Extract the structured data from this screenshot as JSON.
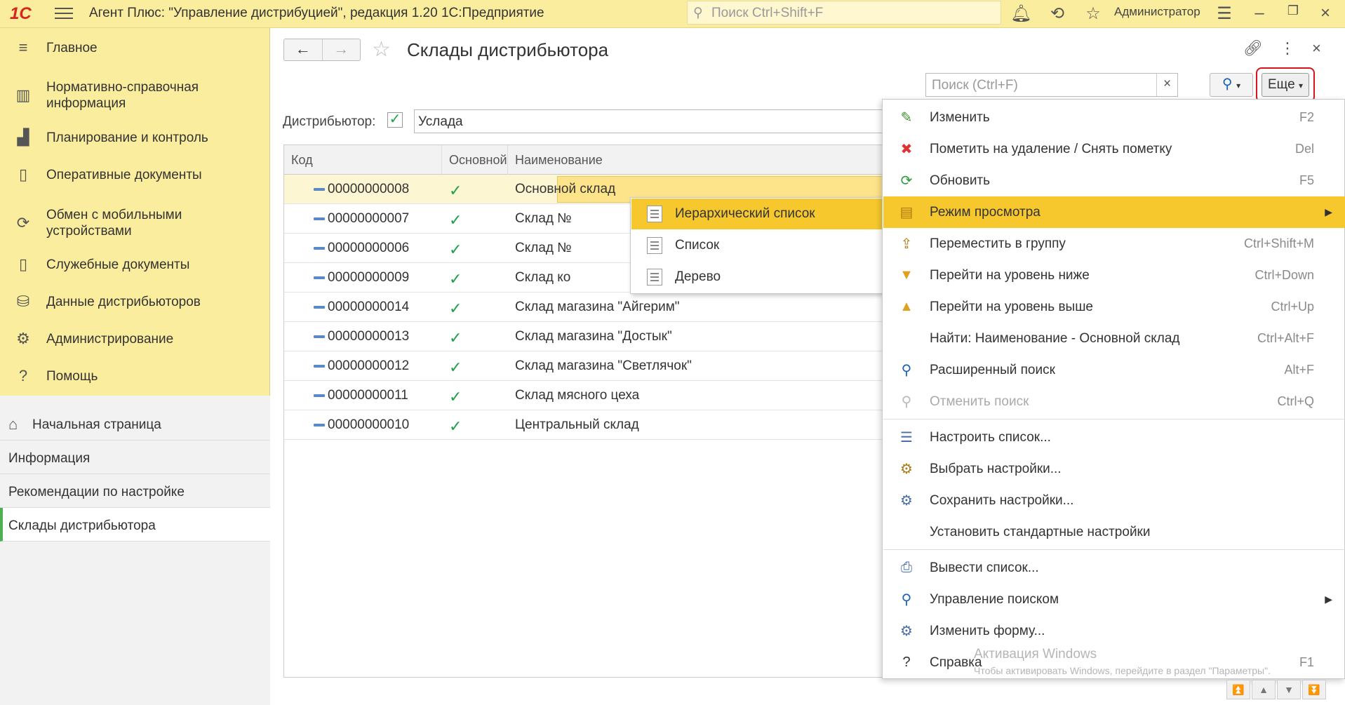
{
  "titlebar": {
    "logo": "1С",
    "app_title": "Агент Плюс: \"Управление дистрибуцией\", редакция 1.20 1С:Предприятие",
    "search_placeholder": "Поиск Ctrl+Shift+F",
    "user": "Администратор"
  },
  "sidebar": {
    "items": [
      {
        "label": "Главное",
        "icon": "menu-lines-icon"
      },
      {
        "label": "Нормативно-справочная информация",
        "icon": "catalog-icon"
      },
      {
        "label": "Планирование и контроль",
        "icon": "bar-chart-icon"
      },
      {
        "label": "Оперативные документы",
        "icon": "documents-icon"
      },
      {
        "label": "Обмен с мобильными устройствами",
        "icon": "sync-icon"
      },
      {
        "label": "Служебные документы",
        "icon": "service-docs-icon"
      },
      {
        "label": "Данные дистрибьюторов",
        "icon": "database-icon"
      },
      {
        "label": "Администрирование",
        "icon": "gear-icon"
      },
      {
        "label": "Помощь",
        "icon": "help-icon"
      }
    ],
    "open_windows": [
      {
        "label": "Начальная страница"
      },
      {
        "label": "Информация"
      },
      {
        "label": "Рекомендации по настройке"
      },
      {
        "label": "Склады дистрибьютора"
      }
    ]
  },
  "form": {
    "title": "Склады дистрибьютора",
    "search_placeholder": "Поиск (Ctrl+F)",
    "more_label": "Еще",
    "distributor_label": "Дистрибьютор:",
    "distributor_value": "Услада"
  },
  "grid": {
    "columns": [
      "Код",
      "Основной",
      "Наименование"
    ],
    "rows": [
      {
        "code": "00000000008",
        "main": "✓",
        "name": "Основной склад"
      },
      {
        "code": "00000000007",
        "main": "✓",
        "name": "Склад №"
      },
      {
        "code": "00000000006",
        "main": "✓",
        "name": "Склад №"
      },
      {
        "code": "00000000009",
        "main": "✓",
        "name": "Склад ко"
      },
      {
        "code": "00000000014",
        "main": "✓",
        "name": "Склад магазина \"Айгерим\""
      },
      {
        "code": "00000000013",
        "main": "✓",
        "name": "Склад магазина \"Достык\""
      },
      {
        "code": "00000000012",
        "main": "✓",
        "name": "Склад магазина \"Светлячок\""
      },
      {
        "code": "00000000011",
        "main": "✓",
        "name": "Склад мясного цеха"
      },
      {
        "code": "00000000010",
        "main": "✓",
        "name": "Центральный склад"
      }
    ]
  },
  "submenu": {
    "items": [
      {
        "label": "Иерархический список"
      },
      {
        "label": "Список"
      },
      {
        "label": "Дерево"
      }
    ]
  },
  "menu": {
    "items": [
      {
        "label": "Изменить",
        "shortcut": "F2",
        "icon": "✎"
      },
      {
        "label": "Пометить на удаление / Снять пометку",
        "shortcut": "Del",
        "icon": "✖"
      },
      {
        "label": "Обновить",
        "shortcut": "F5",
        "icon": "⟳"
      },
      {
        "label": "Режим просмотра",
        "shortcut": "",
        "icon": "▤"
      },
      {
        "label": "Переместить в группу",
        "shortcut": "Ctrl+Shift+M",
        "icon": "⇪"
      },
      {
        "label": "Перейти на уровень ниже",
        "shortcut": "Ctrl+Down",
        "icon": "▼"
      },
      {
        "label": "Перейти на уровень выше",
        "shortcut": "Ctrl+Up",
        "icon": "▲"
      },
      {
        "label": "Найти: Наименование - Основной склад",
        "shortcut": "Ctrl+Alt+F",
        "icon": ""
      },
      {
        "label": "Расширенный поиск",
        "shortcut": "Alt+F",
        "icon": "⚲"
      },
      {
        "label": "Отменить поиск",
        "shortcut": "Ctrl+Q",
        "icon": "⚲"
      },
      {
        "label": "Настроить список...",
        "shortcut": "",
        "icon": "☰"
      },
      {
        "label": "Выбрать настройки...",
        "shortcut": "",
        "icon": "⚙"
      },
      {
        "label": "Сохранить настройки...",
        "shortcut": "",
        "icon": "⚙"
      },
      {
        "label": "Установить стандартные настройки",
        "shortcut": "",
        "icon": ""
      },
      {
        "label": "Вывести список...",
        "shortcut": "",
        "icon": "⎙"
      },
      {
        "label": "Управление поиском",
        "shortcut": "",
        "icon": "⚲"
      },
      {
        "label": "Изменить форму...",
        "shortcut": "",
        "icon": "⚙"
      },
      {
        "label": "Справка",
        "shortcut": "F1",
        "icon": "?"
      }
    ]
  },
  "watermark": {
    "line1": "Активация Windows",
    "line2": "Чтобы активировать Windows, перейдите в раздел \"Параметры\"."
  },
  "colors": {
    "panel": "#fbed9e",
    "highlight": "#f6c82d",
    "check": "#1ea04a",
    "outline": "#d9141d"
  }
}
